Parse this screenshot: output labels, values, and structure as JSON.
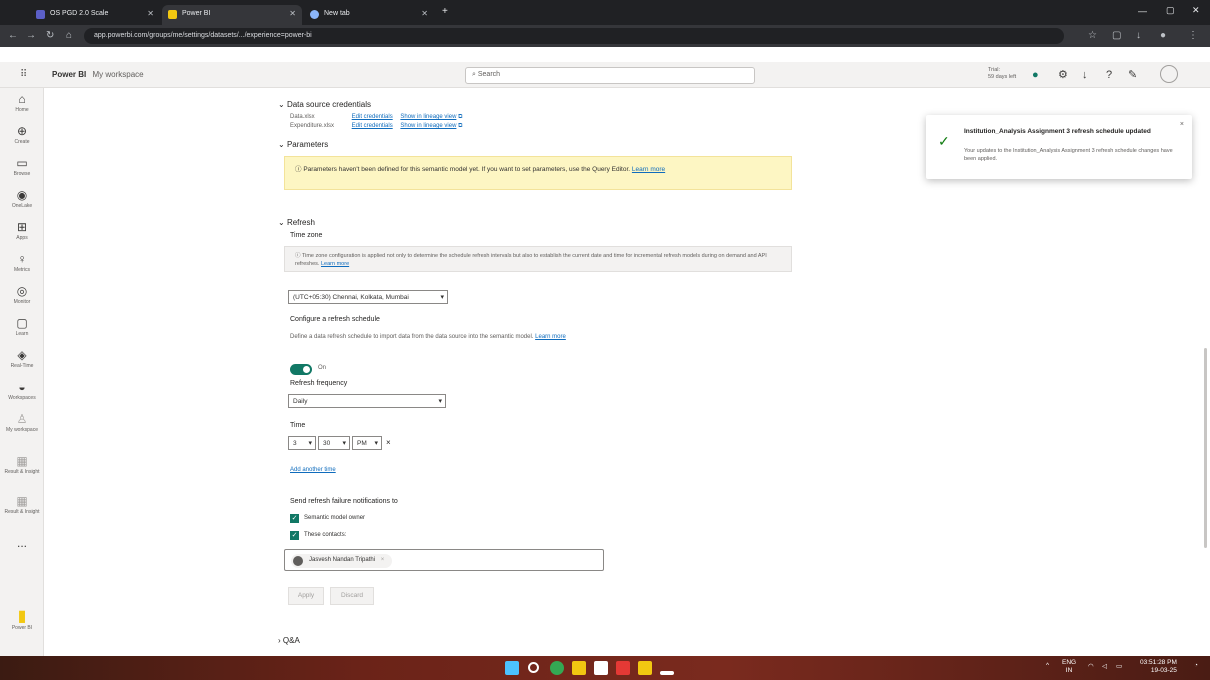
{
  "browser": {
    "tabs": [
      {
        "label": "OS PGD 2.0 Scale",
        "fav_color": "#5b5fc7"
      },
      {
        "label": "Power BI",
        "fav_color": "#f2c811"
      },
      {
        "label": "New tab",
        "fav_color": "#8ab4f8"
      }
    ],
    "new_tab_symbol": "+",
    "url": "app.powerbi.com/groups/me/settings/datasets/.../experience=power-bi"
  },
  "app": {
    "brand": "Power BI",
    "workspace": "My workspace",
    "search_placeholder": "Search",
    "trial_line1": "Trial:",
    "trial_line2": "59 days left"
  },
  "sidebar": {
    "items": [
      {
        "label": "Home",
        "icon": "home-icon",
        "glyph": "⌂"
      },
      {
        "label": "Create",
        "icon": "create-icon",
        "glyph": "⊕"
      },
      {
        "label": "Browse",
        "icon": "browse-icon",
        "glyph": "▭"
      },
      {
        "label": "OneLake",
        "icon": "onelake-icon",
        "glyph": "◉"
      },
      {
        "label": "Apps",
        "icon": "apps-icon",
        "glyph": "⊞"
      },
      {
        "label": "Metrics",
        "icon": "metrics-icon",
        "glyph": "♀"
      },
      {
        "label": "Monitor",
        "icon": "monitor-icon",
        "glyph": "◎"
      },
      {
        "label": "Learn",
        "icon": "learn-icon",
        "glyph": "▢"
      },
      {
        "label": "Real-Time",
        "icon": "realtime-icon",
        "glyph": "◈"
      },
      {
        "label": "Workspaces",
        "icon": "workspaces-icon",
        "glyph": "◒"
      },
      {
        "label": "My workspace",
        "icon": "my-workspace-icon",
        "glyph": "♙"
      },
      {
        "label": "Result & Insight",
        "icon": "report-icon",
        "glyph": "▦"
      },
      {
        "label": "Result & Insight",
        "icon": "report2-icon",
        "glyph": "▦"
      }
    ],
    "more": "...",
    "bottom_label": "Power BI"
  },
  "credentials": {
    "title": "Data source credentials",
    "rows": [
      {
        "name": "Data.xlsx",
        "edit": "Edit credentials",
        "lineage": "Show in lineage view"
      },
      {
        "name": "Expenditure.xlsx",
        "edit": "Edit credentials",
        "lineage": "Show in lineage view"
      }
    ]
  },
  "parameters": {
    "title": "Parameters",
    "message": "Parameters haven't been defined for this semantic model yet. If you want to set parameters, use the Query Editor.",
    "learn_more": "Learn more"
  },
  "refresh": {
    "title": "Refresh",
    "time_zone_label": "Time zone",
    "time_zone_note": "Time zone configuration is applied not only to determine the schedule refresh intervals but also to establish the current date and time for incremental refresh models during on demand and API refreshes.",
    "time_zone_learn": "Learn more",
    "time_zone_value": "(UTC+05:30) Chennai, Kolkata, Mumbai",
    "configure_title": "Configure a refresh schedule",
    "configure_desc": "Define a data refresh schedule to import data from the data source into the semantic model.",
    "configure_learn": "Learn more",
    "toggle_label": "On",
    "toggle_on": true,
    "frequency_label": "Refresh frequency",
    "frequency_value": "Daily",
    "time_label": "Time",
    "hour": "3",
    "minute": "30",
    "ampm": "PM",
    "remove_symbol": "×",
    "add_time": "Add another time",
    "notify_title": "Send refresh failure notifications to",
    "notify_owner": "Semantic model owner",
    "notify_contacts": "These contacts:",
    "contact_name": "Jasvesh Nandan Tripathi",
    "apply": "Apply",
    "discard": "Discard"
  },
  "qa": {
    "title": "Q&A"
  },
  "toast": {
    "title": "Institution_Analysis Assignment 3 refresh schedule updated",
    "body": "Your updates to the Institution_Analysis Assignment 3 refresh schedule changes have been applied.",
    "close": "×"
  },
  "taskbar": {
    "icons": [
      "windows-icon",
      "search-icon",
      "chrome-icon",
      "explorer-icon",
      "store-icon",
      "acrobat-icon",
      "powerbi-icon",
      "app-icon"
    ],
    "icon_colors": [
      "#4cc2ff",
      "#ffffff",
      "#34a853",
      "#f2c811",
      "#ffffff",
      "#e53935",
      "#f2c811",
      "#ffffff"
    ],
    "lang": "ENG",
    "lang2": "IN",
    "time": "03:51:28 PM",
    "date": "19-03-25"
  }
}
